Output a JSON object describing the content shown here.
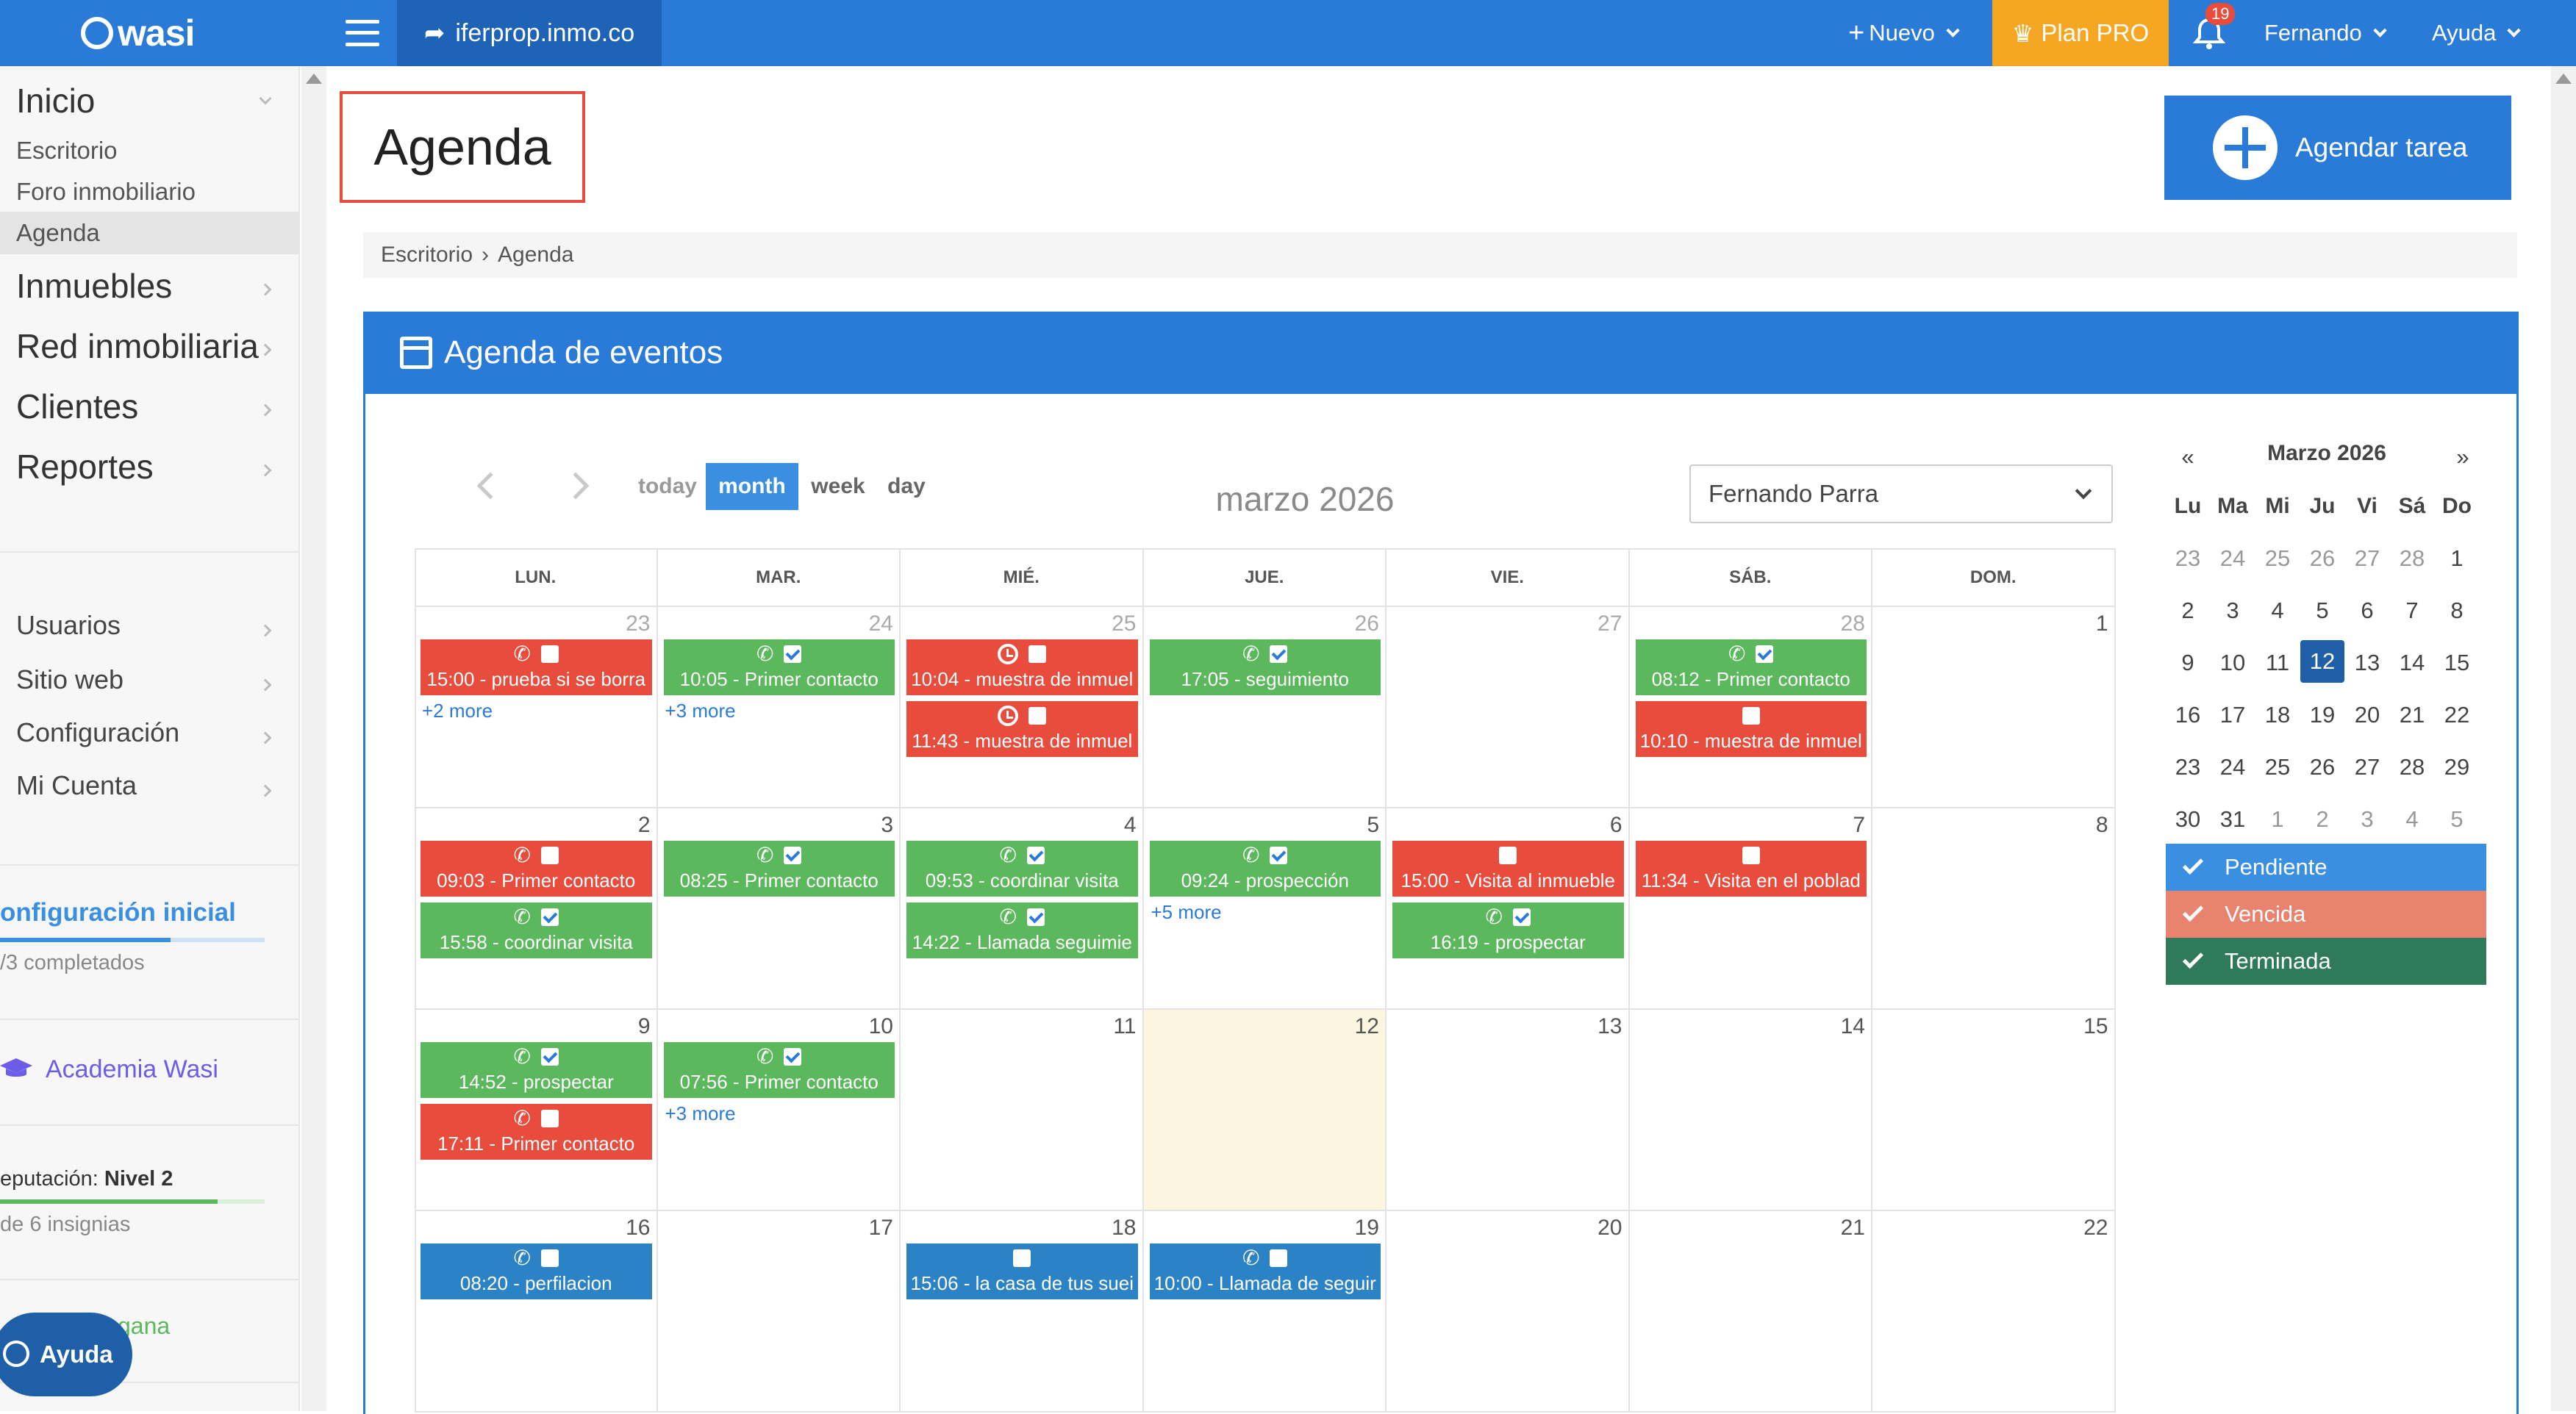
{
  "topbar": {
    "logo": "wasi",
    "site": "iferprop.inmo.co",
    "nuevo": "Nuevo",
    "plan": "Plan PRO",
    "notifications": "19",
    "user": "Fernando",
    "help": "Ayuda"
  },
  "sidebar": {
    "inicio": "Inicio",
    "escritorio": "Escritorio",
    "foro": "Foro inmobiliario",
    "agenda": "Agenda",
    "inmuebles": "Inmuebles",
    "red": "Red inmobiliaria",
    "clientes": "Clientes",
    "reportes": "Reportes",
    "usuarios": "Usuarios",
    "sitio": "Sitio web",
    "config": "Configuración",
    "cuenta": "Mi Cuenta",
    "config_inicial": "onfiguración inicial",
    "completados": "/3 completados",
    "academia": "Academia Wasi",
    "reputacion_label": "eputación:",
    "reputacion_level": "Nivel 2",
    "insignias": "de 6 insignias",
    "gana": "gana",
    "ayuda_bubble": "Ayuda"
  },
  "page": {
    "title": "Agenda",
    "agendar": "Agendar tarea",
    "crumb1": "Escritorio",
    "crumb2": "Agenda",
    "panel_title": "Agenda de eventos"
  },
  "toolbar": {
    "today": "today",
    "month": "month",
    "week": "week",
    "day": "day",
    "title": "marzo 2026",
    "user_select": "Fernando Parra"
  },
  "calendar": {
    "dows": [
      "LUN.",
      "MAR.",
      "MIÉ.",
      "JUE.",
      "VIE.",
      "SÁB.",
      "DOM."
    ],
    "days": [
      [
        "23",
        "24",
        "25",
        "26",
        "27",
        "28",
        "1"
      ],
      [
        "2",
        "3",
        "4",
        "5",
        "6",
        "7",
        "8"
      ],
      [
        "9",
        "10",
        "11",
        "12",
        "13",
        "14",
        "15"
      ],
      [
        "16",
        "17",
        "18",
        "19",
        "20",
        "21",
        "22"
      ]
    ],
    "events": [
      {
        "w": 0,
        "d": 0,
        "slot": 0,
        "color": "red",
        "icon": "phone",
        "check": false,
        "text": "15:00 - prueba si se borra"
      },
      {
        "w": 0,
        "d": 1,
        "slot": 0,
        "color": "green",
        "icon": "phone",
        "check": true,
        "text": "10:05 - Primer contacto"
      },
      {
        "w": 0,
        "d": 2,
        "slot": 0,
        "color": "red",
        "icon": "clock",
        "check": false,
        "text": "10:04 - muestra de inmuel"
      },
      {
        "w": 0,
        "d": 2,
        "slot": 1,
        "color": "red",
        "icon": "clock",
        "check": false,
        "text": "11:43 - muestra de inmuel"
      },
      {
        "w": 0,
        "d": 3,
        "slot": 0,
        "color": "green",
        "icon": "phone",
        "check": true,
        "text": "17:05 - seguimiento"
      },
      {
        "w": 0,
        "d": 5,
        "slot": 0,
        "color": "green",
        "icon": "phone",
        "check": true,
        "text": "08:12 - Primer contacto"
      },
      {
        "w": 0,
        "d": 5,
        "slot": 1,
        "color": "red",
        "icon": "none",
        "check": false,
        "text": "10:10 - muestra de inmuel"
      },
      {
        "w": 1,
        "d": 0,
        "slot": 0,
        "color": "red",
        "icon": "phone",
        "check": false,
        "text": "09:03 - Primer contacto"
      },
      {
        "w": 1,
        "d": 0,
        "slot": 1,
        "color": "green",
        "icon": "phone",
        "check": true,
        "text": "15:58 - coordinar visita"
      },
      {
        "w": 1,
        "d": 1,
        "slot": 0,
        "color": "green",
        "icon": "phone",
        "check": true,
        "text": "08:25 - Primer contacto"
      },
      {
        "w": 1,
        "d": 2,
        "slot": 0,
        "color": "green",
        "icon": "phone",
        "check": true,
        "text": "09:53 - coordinar visita"
      },
      {
        "w": 1,
        "d": 2,
        "slot": 1,
        "color": "green",
        "icon": "phone",
        "check": true,
        "text": "14:22 - Llamada seguimie"
      },
      {
        "w": 1,
        "d": 3,
        "slot": 0,
        "color": "green",
        "icon": "phone",
        "check": true,
        "text": "09:24 - prospección"
      },
      {
        "w": 1,
        "d": 4,
        "slot": 0,
        "color": "red",
        "icon": "none",
        "check": false,
        "text": "15:00 - Visita al inmueble"
      },
      {
        "w": 1,
        "d": 4,
        "slot": 1,
        "color": "green",
        "icon": "phone",
        "check": true,
        "text": "16:19 - prospectar"
      },
      {
        "w": 1,
        "d": 5,
        "slot": 0,
        "color": "red",
        "icon": "none",
        "check": false,
        "text": "11:34 - Visita en el poblad"
      },
      {
        "w": 2,
        "d": 0,
        "slot": 0,
        "color": "green",
        "icon": "phone",
        "check": true,
        "text": "14:52 - prospectar"
      },
      {
        "w": 2,
        "d": 0,
        "slot": 1,
        "color": "red",
        "icon": "phone",
        "check": false,
        "text": "17:11 - Primer contacto"
      },
      {
        "w": 2,
        "d": 1,
        "slot": 0,
        "color": "green",
        "icon": "phone",
        "check": true,
        "text": "07:56 - Primer contacto"
      },
      {
        "w": 3,
        "d": 0,
        "slot": 0,
        "color": "blue",
        "icon": "phone",
        "check": false,
        "text": "08:20 - perfilacion"
      },
      {
        "w": 3,
        "d": 2,
        "slot": 0,
        "color": "blue",
        "icon": "none",
        "check": false,
        "text": "15:06 - la casa de tus suei"
      },
      {
        "w": 3,
        "d": 3,
        "slot": 0,
        "color": "blue",
        "icon": "phone",
        "check": false,
        "text": "10:00 - Llamada de seguir"
      }
    ],
    "more": [
      {
        "w": 0,
        "d": 0,
        "slot": 1,
        "text": "+2 more"
      },
      {
        "w": 0,
        "d": 1,
        "slot": 1,
        "text": "+3 more"
      },
      {
        "w": 1,
        "d": 3,
        "slot": 1,
        "text": "+5 more"
      },
      {
        "w": 2,
        "d": 1,
        "slot": 1,
        "text": "+3 more"
      }
    ]
  },
  "mini": {
    "title": "Marzo 2026",
    "prev": "«",
    "next": "»",
    "dows": [
      "Lu",
      "Ma",
      "Mi",
      "Ju",
      "Vi",
      "Sá",
      "Do"
    ],
    "weeks": [
      [
        "23",
        "24",
        "25",
        "26",
        "27",
        "28",
        "1"
      ],
      [
        "2",
        "3",
        "4",
        "5",
        "6",
        "7",
        "8"
      ],
      [
        "9",
        "10",
        "11",
        "12",
        "13",
        "14",
        "15"
      ],
      [
        "16",
        "17",
        "18",
        "19",
        "20",
        "21",
        "22"
      ],
      [
        "23",
        "24",
        "25",
        "26",
        "27",
        "28",
        "29"
      ],
      [
        "30",
        "31",
        "1",
        "2",
        "3",
        "4",
        "5"
      ]
    ],
    "today": "12"
  },
  "legend": [
    {
      "label": "Pendiente",
      "color": "#3a8fe0"
    },
    {
      "label": "Vencida",
      "color": "#e8836f"
    },
    {
      "label": "Terminada",
      "color": "#2f7a5a"
    }
  ]
}
